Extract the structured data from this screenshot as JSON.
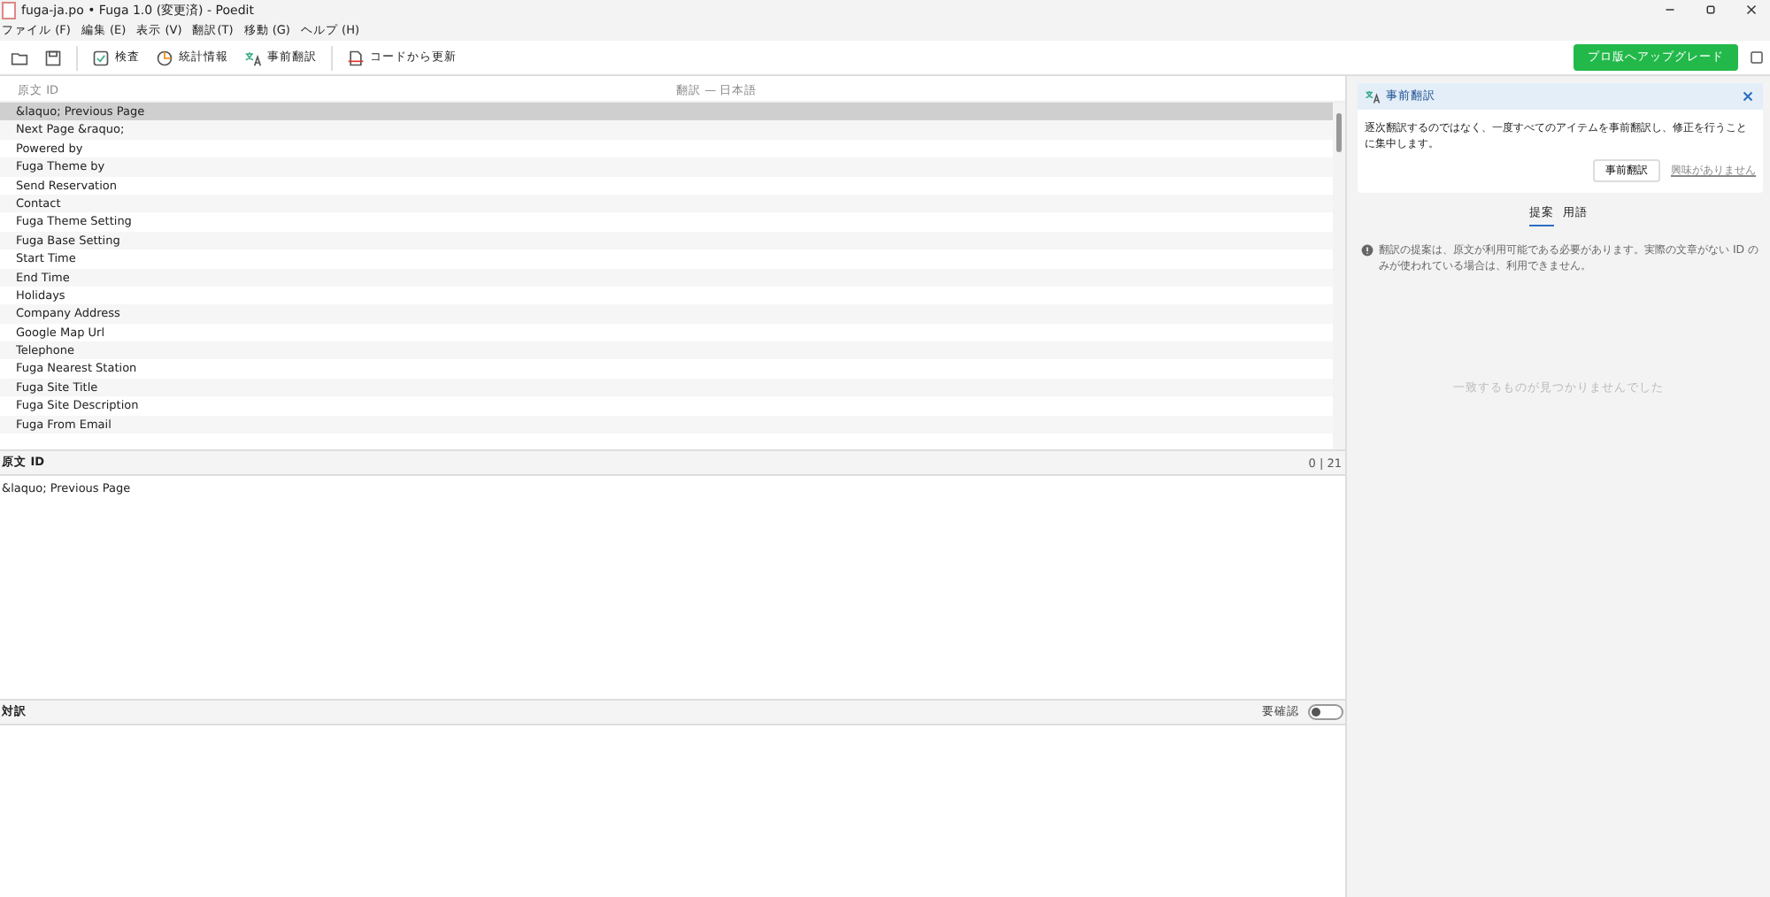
{
  "window": {
    "title": "fuga-ja.po • Fuga 1.0 (変更済) - Poedit"
  },
  "menu": [
    "ファイル (F)",
    "編集 (E)",
    "表示 (V)",
    "翻訳(T)",
    "移動 (G)",
    "ヘルプ (H)"
  ],
  "toolbar": [
    {
      "kind": "open"
    },
    {
      "kind": "save"
    },
    {
      "kind": "check",
      "label": "検査"
    },
    {
      "kind": "stats",
      "label": "統計情報"
    },
    {
      "kind": "translate",
      "label": "事前翻訳"
    },
    {
      "kind": "update",
      "label": "コードから更新"
    }
  ],
  "upgrade_button": "プロ版へアップグレード",
  "list": {
    "columns": [
      "原文 ID",
      "翻訳 — 日本語"
    ],
    "rows": [
      {
        "source": "&laquo; Previous Page",
        "selected": true
      },
      {
        "source": "Next Page &raquo;",
        "selected": false
      },
      {
        "source": "Powered by",
        "selected": false
      },
      {
        "source": "Fuga Theme by",
        "selected": false
      },
      {
        "source": "Send Reservation",
        "selected": false
      },
      {
        "source": "Contact",
        "selected": false
      },
      {
        "source": "Fuga Theme Setting",
        "selected": false
      },
      {
        "source": "Fuga Base Setting",
        "selected": false
      },
      {
        "source": "Start Time",
        "selected": false
      },
      {
        "source": "End Time",
        "selected": false
      },
      {
        "source": "Holidays",
        "selected": false
      },
      {
        "source": "Company Address",
        "selected": false
      },
      {
        "source": "Google Map Url",
        "selected": false
      },
      {
        "source": "Telephone",
        "selected": false
      },
      {
        "source": "Fuga Nearest Station",
        "selected": false
      },
      {
        "source": "Fuga Site Title",
        "selected": false
      },
      {
        "source": "Fuga Site Description",
        "selected": false
      },
      {
        "source": "Fuga From Email",
        "selected": false
      }
    ]
  },
  "source_pane": {
    "heading": "原文 ID",
    "counter": "0 | 21",
    "text": "&laquo; Previous Page"
  },
  "translation_pane": {
    "heading": "対訳",
    "fuzzy_label": "要確認",
    "fuzzy_on": false
  },
  "sidebar": {
    "card": {
      "title": "事前翻訳",
      "text": "逐次翻訳するのではなく、一度すべてのアイテムを事前翻訳し、修正を行うことに集中します。",
      "button": "事前翻訳",
      "link": "興味がありません"
    },
    "tabs": [
      {
        "label": "提案",
        "selected": true
      },
      {
        "label": "用語",
        "selected": false
      }
    ],
    "info": "翻訳の提案は、原文が利用可能である必要があります。実際の文章がない ID のみが使われている場合は、利用できません。",
    "empty_message": "一致するものが見つかりませんでした"
  }
}
